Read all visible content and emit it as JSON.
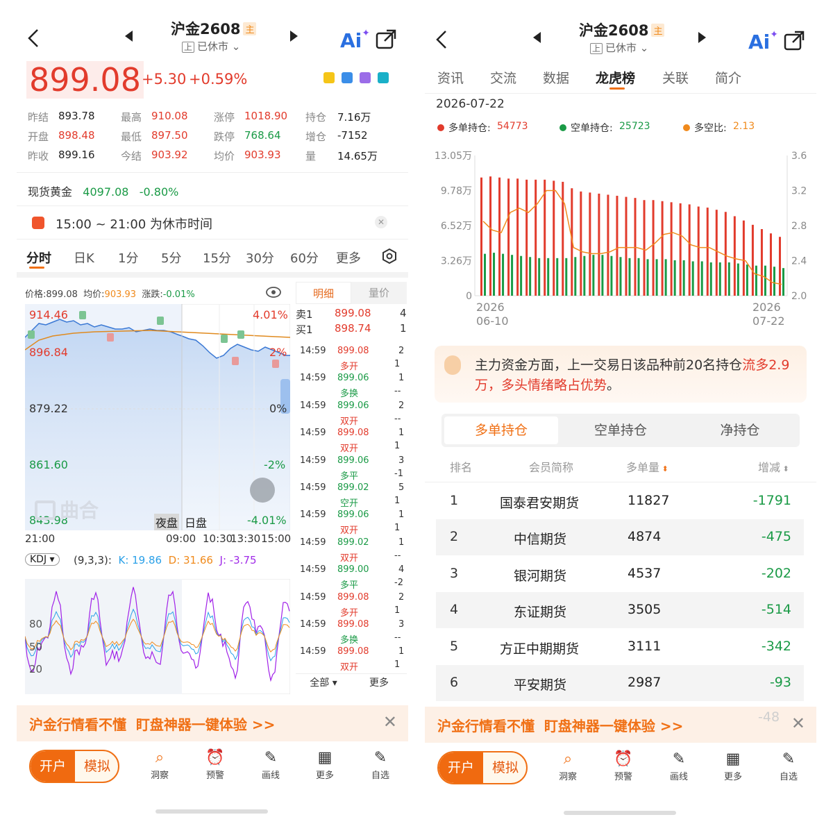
{
  "left": {
    "title": "沪金2608",
    "badge": "主",
    "exchange_tag": "上",
    "status": "已休市",
    "price": "899.08",
    "change": "+5.30",
    "change_pct": "+0.59%",
    "quote": [
      [
        {
          "l": "昨结",
          "v": "893.78",
          "c": "n"
        },
        {
          "l": "最高",
          "v": "910.08",
          "c": "r"
        },
        {
          "l": "涨停",
          "v": "1018.90",
          "c": "r"
        },
        {
          "l": "持仓",
          "v": "7.16万",
          "c": "n"
        }
      ],
      [
        {
          "l": "开盘",
          "v": "898.48",
          "c": "r"
        },
        {
          "l": "最低",
          "v": "897.50",
          "c": "r"
        },
        {
          "l": "跌停",
          "v": "768.64",
          "c": "g"
        },
        {
          "l": "增仓",
          "v": "-7152",
          "c": "n"
        }
      ],
      [
        {
          "l": "昨收",
          "v": "899.16",
          "c": "n"
        },
        {
          "l": "今结",
          "v": "903.92",
          "c": "r"
        },
        {
          "l": "均价",
          "v": "903.93",
          "c": "r"
        },
        {
          "l": "量",
          "v": "14.65万",
          "c": "n"
        }
      ]
    ],
    "spot_label": "现货黄金",
    "spot_price": "4097.08",
    "spot_change": "-0.80%",
    "notice": "15:00 ~ 21:00 为休市时间",
    "period_tabs": [
      "分时",
      "日K",
      "1分",
      "5分",
      "15分",
      "30分",
      "60分",
      "更多"
    ],
    "chart_header": {
      "price_label": "价格:",
      "price": "899.08",
      "avg_label": "均价:",
      "avg": "903.93",
      "chg_label": "涨跌:",
      "chg": "-0.01%"
    },
    "chart_axis": {
      "y_left": [
        "914.46",
        "896.84",
        "879.22",
        "861.60",
        "843.98"
      ],
      "y_right": [
        "4.01%",
        "2%",
        "0%",
        "-2%",
        "-4.01%"
      ],
      "x": [
        "21:00",
        "09:00",
        "10:30",
        "13:30",
        "15:00"
      ]
    },
    "session_tabs": {
      "night": "夜盘",
      "day": "日盘"
    },
    "watermark": "曲合",
    "kdj": {
      "name": "KDJ",
      "params": "(9,3,3):",
      "k": "K: 19.86",
      "d": "D: 31.66",
      "j": "J: -3.75",
      "levels": [
        "80",
        "50",
        "20"
      ]
    },
    "detail_tabs": {
      "detail": "明细",
      "volume": "量价"
    },
    "orderbook": [
      {
        "side": "卖1",
        "price": "899.08",
        "qty": "4"
      },
      {
        "side": "买1",
        "price": "898.74",
        "qty": "1"
      }
    ],
    "trades": [
      {
        "time": "14:59",
        "price": "899.08",
        "qty": "2",
        "type": "多开",
        "tqty": "1"
      },
      {
        "time": "14:59",
        "price": "899.06",
        "qty": "1",
        "type": "多换",
        "tqty": "--"
      },
      {
        "time": "14:59",
        "price": "899.06",
        "qty": "2",
        "type": "双开",
        "tqty": "--"
      },
      {
        "time": "14:59",
        "price": "899.08",
        "qty": "1",
        "type": "双开",
        "tqty": "1"
      },
      {
        "time": "14:59",
        "price": "899.06",
        "qty": "3",
        "type": "多平",
        "tqty": "-1"
      },
      {
        "time": "14:59",
        "price": "899.02",
        "qty": "5",
        "type": "空开",
        "tqty": "1"
      },
      {
        "time": "14:59",
        "price": "899.06",
        "qty": "1",
        "type": "双开",
        "tqty": "1"
      },
      {
        "time": "14:59",
        "price": "899.02",
        "qty": "1",
        "type": "双开",
        "tqty": "--"
      },
      {
        "time": "14:59",
        "price": "899.00",
        "qty": "4",
        "type": "多平",
        "tqty": "-2"
      },
      {
        "time": "14:59",
        "price": "899.08",
        "qty": "2",
        "type": "多开",
        "tqty": "1"
      },
      {
        "time": "14:59",
        "price": "899.08",
        "qty": "3",
        "type": "多换",
        "tqty": "--"
      },
      {
        "time": "14:59",
        "price": "899.08",
        "qty": "1",
        "type": "双开",
        "tqty": "1"
      }
    ],
    "detail_footer": {
      "all": "全部",
      "more": "更多"
    }
  },
  "right": {
    "title": "沪金2608",
    "badge": "主",
    "exchange_tag": "上",
    "status": "已休市",
    "tabs": [
      "资讯",
      "交流",
      "数据",
      "龙虎榜",
      "关联",
      "简介"
    ],
    "active_tab": "龙虎榜",
    "date": "2026-07-22",
    "legend": [
      {
        "name": "多单持仓:",
        "value": "54773",
        "color": "#e23b2c"
      },
      {
        "name": "空单持仓:",
        "value": "25723",
        "color": "#1a9a46"
      },
      {
        "name": "多空比:",
        "value": "2.13",
        "color": "#f08a1c"
      }
    ],
    "insight_prefix": "主力资金方面，上一交易日该品种前20名持仓",
    "insight_highlight": "流多2.9万，多头情绪略占优势",
    "insight_suffix": "。",
    "sub_tabs": [
      "多单持仓",
      "空单持仓",
      "净持仓"
    ],
    "table_headers": {
      "rank": "排名",
      "member": "会员简称",
      "volume": "多单量",
      "change": "增减"
    },
    "rows": [
      {
        "rank": "1",
        "member": "国泰君安期货",
        "volume": "11827",
        "change": "-1791"
      },
      {
        "rank": "2",
        "member": "中信期货",
        "volume": "4874",
        "change": "-475"
      },
      {
        "rank": "3",
        "member": "银河期货",
        "volume": "4537",
        "change": "-202"
      },
      {
        "rank": "4",
        "member": "东证期货",
        "volume": "3505",
        "change": "-514"
      },
      {
        "rank": "5",
        "member": "方正中期期货",
        "volume": "3111",
        "change": "-342"
      },
      {
        "rank": "6",
        "member": "平安期货",
        "volume": "2987",
        "change": "-93"
      }
    ],
    "partial_row_change": "-48"
  },
  "chart_data": {
    "type": "bar",
    "title": "",
    "x_start": "2026\n06-10",
    "x_end": "2026\n07-22",
    "x_tick_labels": [
      "2026 06-10",
      "2026 07-22"
    ],
    "y_left_ticks": [
      "0",
      "3.26万",
      "6.52万",
      "9.78万",
      "13.05万"
    ],
    "y_left_lim": [
      0,
      130500
    ],
    "y_right_ticks": [
      "2.0",
      "2.4",
      "2.8",
      "3.2",
      "3.6"
    ],
    "y_right_lim": [
      2.0,
      3.6
    ],
    "series": [
      {
        "name": "多单持仓",
        "kind": "bar",
        "values": [
          110000,
          111000,
          110000,
          109000,
          109000,
          108000,
          108000,
          108000,
          107000,
          106000,
          100000,
          97000,
          96000,
          95000,
          94000,
          93000,
          92000,
          91000,
          89000,
          89000,
          88000,
          87000,
          86000,
          85000,
          83000,
          82000,
          80000,
          78000,
          74000,
          70000,
          66000,
          62000,
          58000,
          54773
        ]
      },
      {
        "name": "空单持仓",
        "kind": "bar",
        "values": [
          39000,
          40000,
          39000,
          38000,
          37000,
          36000,
          35000,
          35000,
          35000,
          35000,
          36000,
          37000,
          38000,
          38000,
          37000,
          36000,
          35000,
          35000,
          34000,
          34000,
          34000,
          33000,
          33000,
          32000,
          32000,
          31000,
          31000,
          31000,
          30000,
          29000,
          28000,
          28000,
          27000,
          25723
        ]
      },
      {
        "name": "多空比",
        "kind": "line",
        "values": [
          2.85,
          2.75,
          2.72,
          2.95,
          3.0,
          2.95,
          3.05,
          3.2,
          3.2,
          3.05,
          2.55,
          2.5,
          2.48,
          2.48,
          2.5,
          2.55,
          2.55,
          2.55,
          2.52,
          2.6,
          2.7,
          2.72,
          2.68,
          2.58,
          2.55,
          2.55,
          2.5,
          2.45,
          2.42,
          2.4,
          2.25,
          2.22,
          2.15,
          2.13
        ]
      }
    ]
  }
}
